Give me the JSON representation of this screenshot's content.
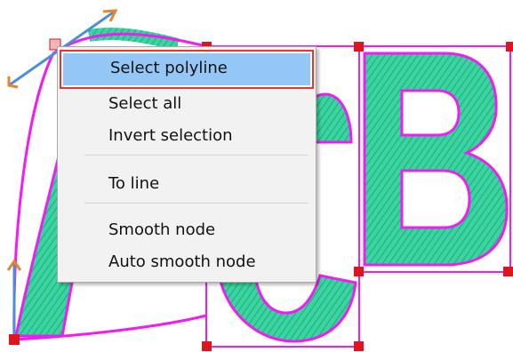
{
  "context_menu": {
    "items": [
      {
        "label": "Select polyline",
        "selected": true
      },
      {
        "label": "Select all"
      },
      {
        "label": "Invert selection"
      },
      {
        "label": "To line"
      },
      {
        "label": "Smooth node"
      },
      {
        "label": "Auto smooth node"
      }
    ]
  },
  "colors": {
    "outline": "#f21bf2",
    "stitch": "#3ad4a0",
    "stitch_dark": "#1e9c72",
    "node": "#e0141c",
    "handle": "#4a90d9",
    "handle_arrow": "#e8842a",
    "highlight": "#94c7f5",
    "highlight_border": "#e8352f"
  }
}
